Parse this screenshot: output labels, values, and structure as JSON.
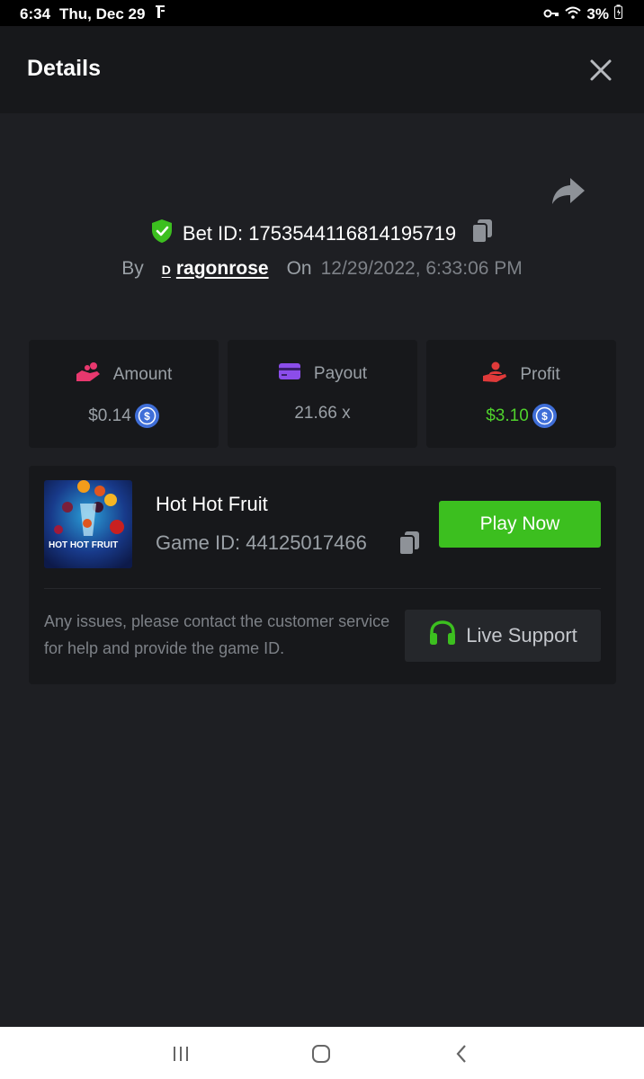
{
  "status_bar": {
    "time": "6:34",
    "date": "Thu, Dec 29",
    "battery": "3%"
  },
  "header": {
    "title": "Details"
  },
  "bet": {
    "id_label": "Bet ID: 1753544116814195719",
    "by_label": "By",
    "user_badge": "D",
    "username": "ragonrose",
    "on_label": "On",
    "datetime": "12/29/2022, 6:33:06 PM"
  },
  "stats": {
    "amount_label": "Amount",
    "amount_value": "$0.14",
    "payout_label": "Payout",
    "payout_value": "21.66 x",
    "profit_label": "Profit",
    "profit_value": "$3.10"
  },
  "game": {
    "name": "Hot Hot Fruit",
    "id_label": "Game ID: 44125017466",
    "thumb_text": "HOT HOT FRUIT",
    "play_label": "Play Now",
    "help_text": "Any issues, please contact the customer service for help and provide the game ID.",
    "support_label": "Live Support"
  },
  "icons": {
    "shield": "shield-check-icon",
    "copy": "copy-icon",
    "share": "share-icon",
    "close": "close-icon",
    "amount": "hand-coins-icon",
    "payout": "credit-card-icon",
    "profit": "hand-user-icon",
    "coin": "usdc-coin-icon",
    "headset": "headset-icon"
  },
  "colors": {
    "accent_green": "#3cbf1f",
    "profit_green": "#4fd12c",
    "amount_icon": "#e8386e",
    "payout_icon": "#8b4dea",
    "profit_icon": "#e03a3a",
    "coin": "#3f6ed8"
  }
}
